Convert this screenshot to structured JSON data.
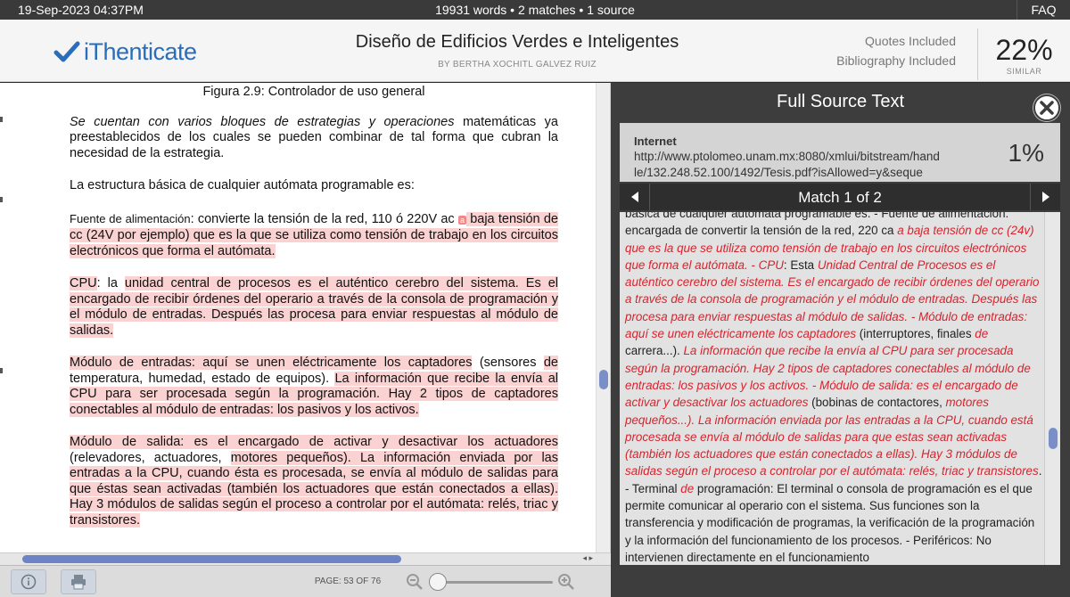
{
  "topbar": {
    "datetime": "19-Sep-2023 04:37PM",
    "summary": "19931 words • 2 matches • 1 source",
    "faq": "FAQ"
  },
  "header": {
    "brand": "iThenticate",
    "title": "Diseño de Edificios Verdes e Inteligentes",
    "author": "BY BERTHA XOCHITL GALVEZ RUIZ",
    "quotes": "Quotes Included",
    "bibliography": "Bibliography Included",
    "similarity_pct": "22%",
    "similarity_label": "SIMILAR"
  },
  "document": {
    "figure_caption": "Figura 2.9: Controlador de uso general",
    "p1_italic": "Se cuentan con varios bloques de estrategias y operaciones",
    "p1_rest": " matemáticas ya preestablecidos de los cuales se pueden combinar de tal forma que cubran la necesidad de la estrategia.",
    "p2": "La estructura básica de cualquier autómata programable es:",
    "p3_lead": "Fuente de alimentación",
    "p3_a": ": convierte la tensión de la red, 110 ó 220V ac ",
    "p3_marker": "a",
    "p3_b": " baja tensión de cc (24V por ejemplo) que es la que se utiliza como tensión de trabajo en los circuitos electrónicos que forma el autómata.",
    "p4_a": "CPU",
    "p4_b": ": la ",
    "p4_c": "unidad central de procesos es el auténtico cerebro del sistema. Es el encargado de recibir órdenes del operario a través de la consola de programación y el módulo de entradas. Después las procesa para enviar respuestas al módulo de salidas.",
    "p5_a": "Módulo de entradas: aquí se unen eléctricamente los captadores",
    "p5_b": " (sensores ",
    "p5_c": "de",
    "p5_d": " temperatura, humedad, estado de equipos). ",
    "p5_e": "La información que recibe la envía al CPU para ser procesada según la programación. Hay 2 tipos de captadores conectables al módulo de entradas: los pasivos y los activos.",
    "p6_a": "Módulo de salida: es el encargado de activar y desactivar los actuadores",
    "p6_b": " (relevadores, actuadores, ",
    "p6_c": "motores pequeños). La información enviada por las entradas a la CPU, cuando ésta es procesada, se envía al módulo de salidas para que éstas sean activadas (también los actuadores que están conectados a ellas). Hay 3 módulos de salidas según el proceso a controlar por el autómata: relés, triac y transistores."
  },
  "toolbar": {
    "page_info": "PAGE: 53 OF 76"
  },
  "source_panel": {
    "title": "Full Source Text",
    "source_type": "Internet",
    "source_url": "http://www.ptolomeo.unam.mx:8080/xmlui/bitstream/handle/132.248.52.100/1492/Tesis.pdf?isAllowed=y&seque",
    "source_pct": "1%",
    "match_label": "Match 1 of 2",
    "t1": "básica de cualquier autómata programable es. - Fuente de alimentación: encargada de convertir la tensión de la red, 220 ca ",
    "m1": "a baja tensión de cc (24v) que es la que se utiliza como tensión de trabajo en los circuitos electrónicos que forma el autómata. - CPU",
    "t2": ": Esta ",
    "m2": "Unidad Central de Procesos es el auténtico cerebro del sistema. Es el encargado de recibir órdenes del operario a través de la consola de programación y el módulo de entradas. Después las procesa para enviar respuestas al módulo de salidas. - Módulo de entradas: aquí se unen eléctricamente los captadores",
    "t3": " (interruptores, finales ",
    "m3": "de",
    "t4": " carrera...). ",
    "m4": "La información que recibe la envía al CPU para ser procesada según la programación. Hay 2 tipos de captadores conectables al módulo de entradas: los pasivos y los activos. - Módulo de salida: es el encargado de activar y desactivar los actuadores",
    "t5": " (bobinas de contactores, ",
    "m5": "motores pequeños...). La información enviada por las entradas a la CPU, cuando está procesada se envía al módulo de salidas para que estas sean activadas (también los actuadores que están conectados a ellas). Hay 3 módulos de salidas según el proceso a controlar por el autómata: relés, triac y transistores",
    "t6": ". - Terminal ",
    "m6": "de",
    "t7": " programación: El terminal o consola de programación es el que permite comunicar al operario con el sistema. Sus funciones son la transferencia y modificación de programas, la verificación de la programación y la información del funcionamiento de los procesos. - Periféricos: No intervienen directamente en el funcionamiento"
  },
  "colors": {
    "highlight": "#fbd2d2",
    "match_text": "#d9232d",
    "brand": "#2a6ebb"
  },
  "icons": [
    "check-logo-icon",
    "info-icon",
    "print-icon",
    "zoom-out-icon",
    "zoom-in-icon",
    "close-icon",
    "prev-arrow-icon",
    "next-arrow-icon"
  ]
}
